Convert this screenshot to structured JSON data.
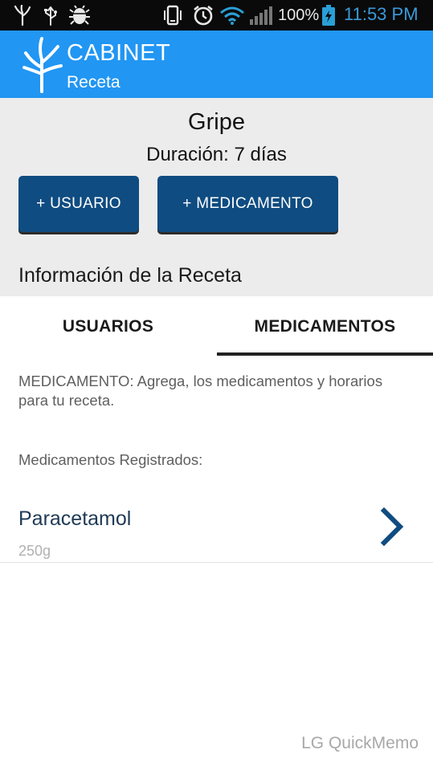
{
  "status_bar": {
    "battery": "100%",
    "time": "11:53 PM",
    "icons": [
      "app-logo-icon",
      "usb-icon",
      "android-debug-icon",
      "vibrate-icon",
      "alarm-icon",
      "wifi-icon",
      "signal-icon",
      "battery-charging-icon"
    ]
  },
  "app_bar": {
    "title": "CABINET",
    "subtitle": "Receta",
    "color": "#2196f3"
  },
  "recipe": {
    "name": "Gripe",
    "duration": "Duración: 7 días",
    "add_user_label": "+ USUARIO",
    "add_medication_label": "+ MEDICAMENTO",
    "section_title": "Información de la Receta",
    "button_color": "#0f4c81"
  },
  "tabs": [
    {
      "label": "USUARIOS",
      "selected": false
    },
    {
      "label": "MEDICAMENTOS",
      "selected": true
    }
  ],
  "content": {
    "description": "MEDICAMENTO: Agrega, los medicamentos y horarios para tu receta.",
    "registered_label": "Medicamentos Registrados:",
    "medications": [
      {
        "name": "Paracetamol",
        "dose": "250g",
        "icon": "chevron-right-icon"
      }
    ]
  },
  "watermark": "LG QuickMemo"
}
